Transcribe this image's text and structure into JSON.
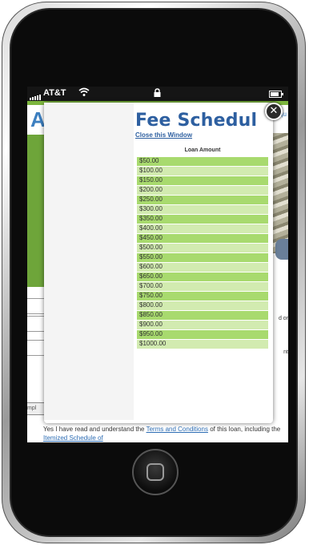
{
  "status_bar": {
    "carrier": "AT&T"
  },
  "background_page": {
    "logo_fragment": "A",
    "header_fragment": "qu",
    "side_note_1": "d or",
    "side_note_2": "nt",
    "pill_fragment": "mpl",
    "bottom_text_prefix": "Yes",
    "bottom_text_hidden": "I have read and understand the",
    "terms_link": "Terms and Conditions",
    "bottom_text_mid": "of this loan, including the",
    "schedule_link": "Itemized Schedule of"
  },
  "modal": {
    "title": "Fee Schedul",
    "close_link": "Close this Window",
    "column_header": "Loan Amount",
    "rows": [
      "$50.00",
      "$100.00",
      "$150.00",
      "$200.00",
      "$250.00",
      "$300.00",
      "$350.00",
      "$400.00",
      "$450.00",
      "$500.00",
      "$550.00",
      "$600.00",
      "$650.00",
      "$700.00",
      "$750.00",
      "$800.00",
      "$850.00",
      "$900.00",
      "$950.00",
      "$1000.00"
    ],
    "close_button": "✕"
  },
  "colors": {
    "accent_green": "#7cb53e",
    "title_blue": "#2d5fa0",
    "row_odd": "#a8da6e",
    "row_even": "#d2ebb0"
  }
}
